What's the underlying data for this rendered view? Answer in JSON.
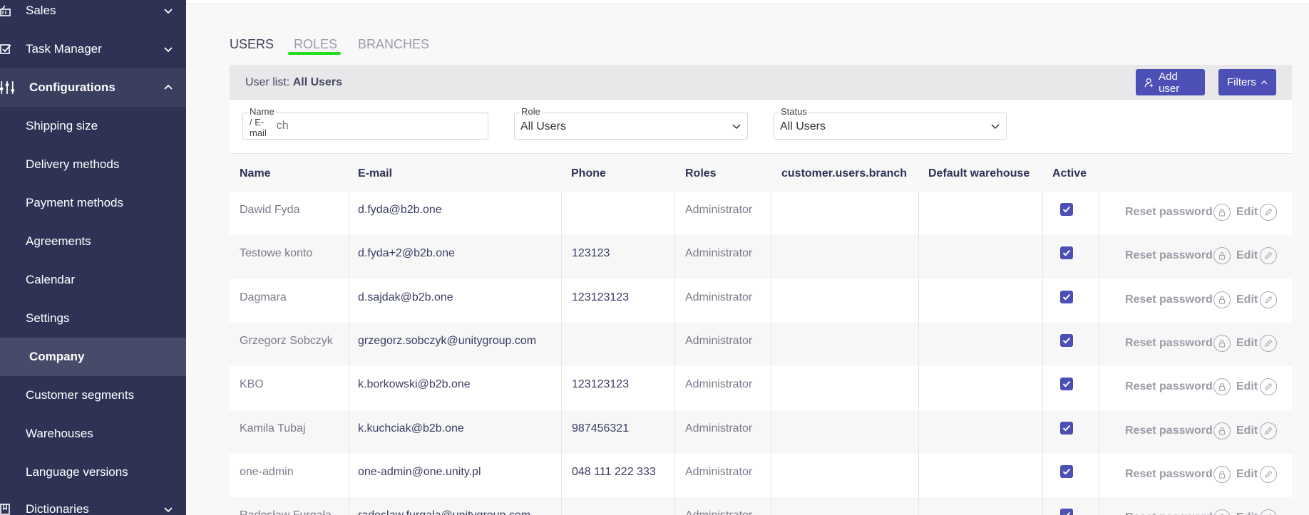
{
  "sidebar": {
    "items": [
      {
        "label": "Sales",
        "icon": "basket-icon",
        "chevron": "down"
      },
      {
        "label": "Task Manager",
        "icon": "checklist-icon",
        "chevron": "down"
      },
      {
        "label": "Configurations",
        "icon": "sliders-icon",
        "chevron": "up"
      },
      {
        "label": "Shipping size"
      },
      {
        "label": "Delivery methods"
      },
      {
        "label": "Payment methods"
      },
      {
        "label": "Agreements"
      },
      {
        "label": "Calendar"
      },
      {
        "label": "Settings"
      },
      {
        "label": "Company"
      },
      {
        "label": "Customer segments"
      },
      {
        "label": "Warehouses"
      },
      {
        "label": "Language versions"
      },
      {
        "label": "Dictionaries",
        "icon": "book-icon",
        "chevron": "down"
      }
    ]
  },
  "tabs": {
    "users": "USERS",
    "roles": "ROLES",
    "branches": "BRANCHES"
  },
  "header": {
    "prefix": "User list:",
    "value": "All Users",
    "add_user": "Add user",
    "filters": "Filters"
  },
  "filters": {
    "name_label": "Name / E-mail",
    "name_placeholder": "Search",
    "role_label": "Role",
    "role_value": "All Users",
    "status_label": "Status",
    "status_value": "All Users"
  },
  "table": {
    "columns": [
      "Name",
      "E-mail",
      "Phone",
      "Roles",
      "customer.users.branch",
      "Default warehouse",
      "Active"
    ],
    "reset_label": "Reset password",
    "edit_label": "Edit",
    "rows": [
      {
        "name": "Dawid Fyda",
        "email": "d.fyda@b2b.one",
        "phone": "",
        "role": "Administrator"
      },
      {
        "name": "Testowe konto",
        "email": "d.fyda+2@b2b.one",
        "phone": "123123",
        "role": "Administrator"
      },
      {
        "name": "Dagmara",
        "email": "d.sajdak@b2b.one",
        "phone": "123123123",
        "role": "Administrator"
      },
      {
        "name": "Grzegorz Sobczyk",
        "email": "grzegorz.sobczyk@unitygroup.com",
        "phone": "",
        "role": "Administrator"
      },
      {
        "name": "KBO",
        "email": "k.borkowski@b2b.one",
        "phone": "123123123",
        "role": "Administrator"
      },
      {
        "name": "Kamila Tubaj",
        "email": "k.kuchciak@b2b.one",
        "phone": "987456321",
        "role": "Administrator"
      },
      {
        "name": "one-admin",
        "email": "one-admin@one.unity.pl",
        "phone": "048 111 222 333",
        "role": "Administrator"
      },
      {
        "name": "Radosław Furgała",
        "email": "radoslaw.furgala@unitygroup.com",
        "phone": "",
        "role": "Administrator"
      }
    ]
  }
}
